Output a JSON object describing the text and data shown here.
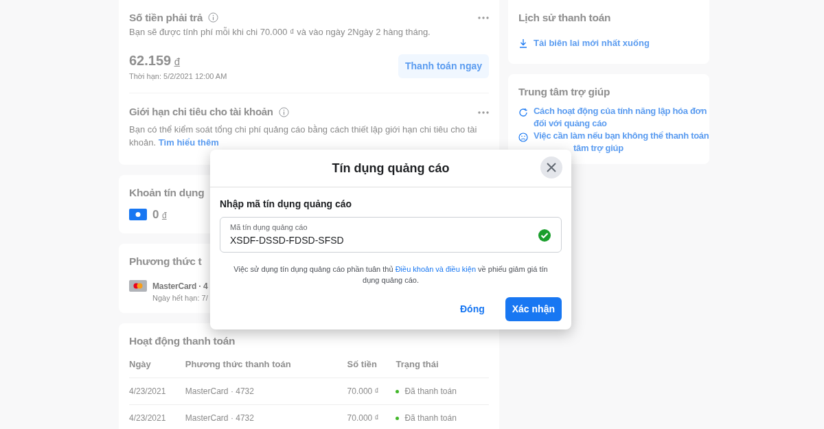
{
  "summary": {
    "title": "Số tiền phải trả",
    "subtitle": "Bạn sẽ được tính phí mỗi khi chi 70.000 ₫ và vào ngày 2Ngày 2 hàng tháng.",
    "amount": "62.159",
    "currency": "đ",
    "due": "Thời hạn: 5/2/2021 12:00 AM",
    "pay_button": "Thanh toán ngay"
  },
  "spending_limit": {
    "title": "Giới hạn chi tiêu cho tài khoản",
    "text": "Bạn có thể kiểm soát tổng chi phí quảng cáo bằng cách thiết lập giới hạn chi tiêu cho tài khoản.",
    "link": "Tìm hiểu thêm"
  },
  "credit": {
    "title": "Khoản tín dụng",
    "amount": "0",
    "currency": "đ"
  },
  "payment_method": {
    "title": "Phương thức t",
    "card": "MasterCard · 4",
    "expiry": "Ngày hết hạn: 7/"
  },
  "activity": {
    "title": "Hoạt động thanh toán",
    "columns": [
      "Ngày",
      "Phương thức thanh toán",
      "Số tiền",
      "Trạng thái"
    ],
    "rows": [
      {
        "date": "4/23/2021",
        "method": "MasterCard · 4732",
        "amount": "70.000 ₫",
        "status": "Đã thanh toán",
        "color": "#42b72a"
      },
      {
        "date": "4/23/2021",
        "method": "MasterCard · 4732",
        "amount": "70.000 ₫",
        "status": "Đã thanh toán",
        "color": "#42b72a"
      }
    ]
  },
  "history": {
    "title": "Lịch sử thanh toán",
    "link": "Tải biên lai mới nhất xuống"
  },
  "help": {
    "title": "Trung tâm trợ giúp",
    "links": [
      {
        "kind": "cycle",
        "text": "Cách hoạt động của tính năng lập hóa đơn đối với quảng cáo"
      },
      {
        "kind": "face",
        "text": "Việc cần làm nếu bạn không thể thanh toán"
      },
      {
        "kind": "none",
        "text": "tâm trợ giúp"
      }
    ]
  },
  "modal": {
    "title": "Tín dụng quảng cáo",
    "heading": "Nhập mã tín dụng quảng cáo",
    "field": {
      "label": "Mã tín dụng quảng cáo",
      "value": "XSDF-DSSD-FDSD-SFSD",
      "valid": true
    },
    "note_before": "Việc sử dụng tín dụng quảng cáo phần tuân thủ",
    "note_link": "Điều khoản và điều kiện",
    "note_after": "về phiếu giảm giá tín dụng quảng cáo.",
    "close_button": "Đóng",
    "confirm_button": "Xác nhận"
  }
}
